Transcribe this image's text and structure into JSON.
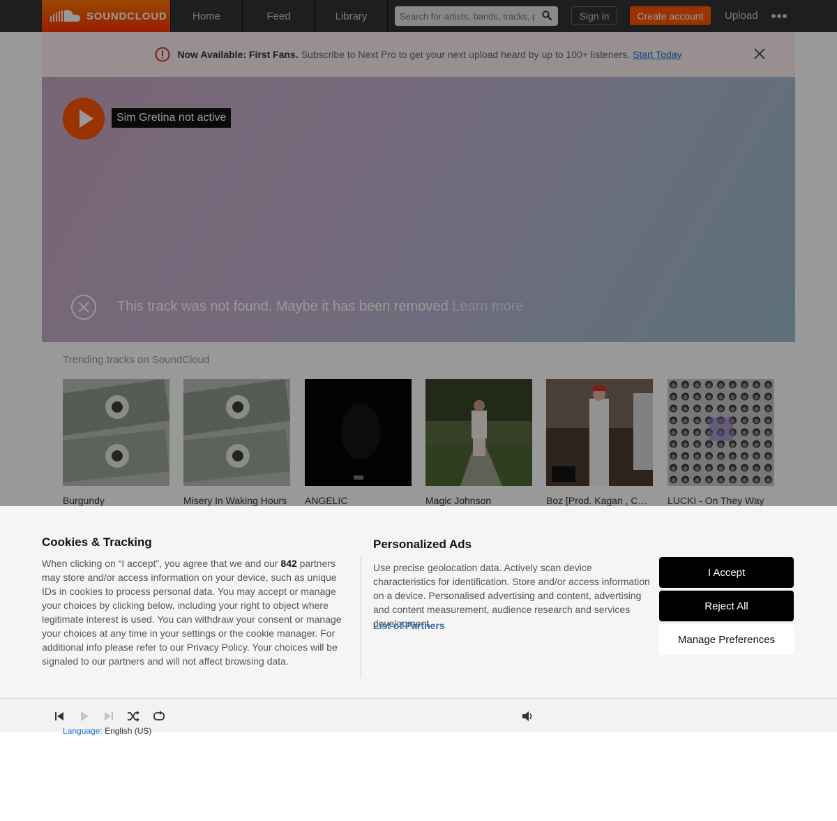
{
  "header": {
    "logo_text": "SOUNDCLOUD",
    "nav": [
      "Home",
      "Feed",
      "Library"
    ],
    "search_placeholder": "Search for artists, bands, tracks, podcasts",
    "sign_in": "Sign in",
    "create_account": "Create account",
    "upload": "Upload"
  },
  "banner": {
    "strong": "Now Available: First Fans.",
    "text": "Subscribe to Next Pro to get your next upload heard by up to 100+ listeners.",
    "link": "Start Today"
  },
  "hero": {
    "title": "Sim Gretina not active",
    "not_found": "This track was not found. Maybe it has been removed",
    "learn_more": "Learn more"
  },
  "trending": {
    "heading": "Trending tracks on SoundCloud",
    "tracks": [
      {
        "title": "Burgundy"
      },
      {
        "title": "Misery In Waking Hours"
      },
      {
        "title": "ANGELIC"
      },
      {
        "title": "Magic Johnson"
      },
      {
        "title": "Boz [Prod. Kagan , Cha..."
      },
      {
        "title": "LUCKI - On They Way"
      }
    ]
  },
  "footer": {
    "language_label": "Language:",
    "language_value": "English (US)"
  },
  "consent": {
    "title": "Cookies & Tracking",
    "body_before": "When clicking on “I accept”, you agree that we and our",
    "partner_count": "842",
    "body_after": "partners may store and/or access information on your device, such as unique IDs in cookies to process personal data. You may accept or manage your choices by clicking below, including your right to object where legitimate interest is used. You can withdraw your consent or manage your choices at any time in your settings or the cookie manager. For additional info please refer to our Privacy Policy. Your choices will be signaled to our partners and will not affect browsing data.",
    "ads_title": "Personalized Ads",
    "ads_body": "Use precise geolocation data. Actively scan device characteristics for identification. Store and/or access information on a device. Personalised advertising and content, advertising and content measurement, audience research and services development.",
    "partners_link": "List of Partners",
    "accept": "I Accept",
    "reject": "Reject All",
    "manage": "Manage Preferences"
  },
  "colors": {
    "brand": "#ff5500",
    "header_bg": "#333333",
    "link": "#1a6fd6"
  }
}
